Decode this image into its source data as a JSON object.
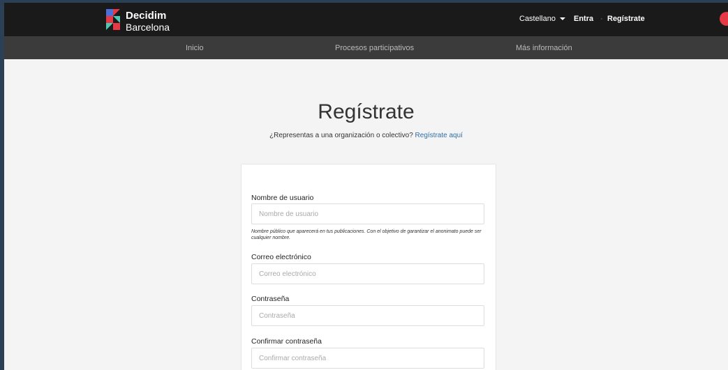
{
  "header": {
    "brand_line1": "Decidim",
    "brand_line2": "Barcelona",
    "language": "Castellano",
    "login": "Entra",
    "separator": "·",
    "signup": "Regístrate"
  },
  "nav": {
    "items": [
      "Inicio",
      "Procesos participativos",
      "Más información"
    ]
  },
  "main": {
    "title": "Regístrate",
    "subtitle_text": "¿Representas a una organización o colectivo?",
    "subtitle_link": "Regístrate aquí"
  },
  "form": {
    "username": {
      "label": "Nombre de usuario",
      "placeholder": "Nombre de usuario",
      "value": "",
      "help": "Nombre público que aparecerá en tus publicaciones. Con el objetivo de garantizar el anonimato puede ser cualquier nombre."
    },
    "email": {
      "label": "Correo electrónico",
      "placeholder": "Correo electrónico",
      "value": ""
    },
    "password": {
      "label": "Contraseña",
      "placeholder": "Contraseña",
      "value": ""
    },
    "password_confirmation": {
      "label": "Confirmar contraseña",
      "placeholder": "Confirmar contraseña",
      "value": ""
    }
  },
  "colors": {
    "accent": "#2f6fa5",
    "topbar": "#1a1a1a",
    "navbar": "#3b3b3b",
    "logo_red": "#e63946",
    "logo_blue": "#4f6fd8",
    "logo_teal": "#4fc7b6"
  },
  "icons": {
    "logo": "decidim-logo-icon",
    "language_caret": "caret-down-icon",
    "city": "barcelona-city-icon"
  }
}
